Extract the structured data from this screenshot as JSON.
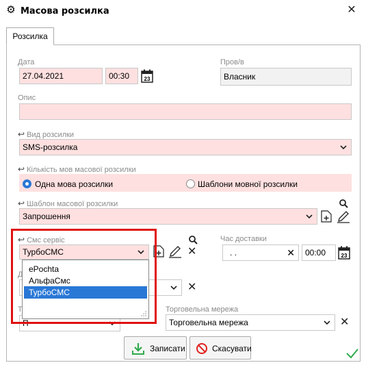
{
  "window": {
    "title": "Масова розсилка",
    "icon": "gear-icon",
    "close_icon": "close-icon"
  },
  "tab": {
    "label": "Розсилка"
  },
  "form": {
    "date_label": "Дата",
    "date_value": "27.04.2021",
    "time_value": "00:30",
    "provod_label": "Пров/в",
    "provod_value": "Власник",
    "description_label": "Опис",
    "description_value": "",
    "mailing_type_label": "Вид розсилки",
    "mailing_type_value": "SMS-розсилка",
    "lang_count_label": "Кількість мов масової розсилки",
    "lang_option_1": "Одна мова розсилки",
    "lang_option_2": "Шаблони мовної розсилки",
    "lang_selected": "Одна мова розсилки",
    "template_label": "Шаблон масової розсилки",
    "template_value": "Запрошення",
    "sms_service_label": "Смс сервіс",
    "sms_service_value": "ТурбоСМС",
    "delivery_time_label": "Час доставки",
    "delivery_date_value": " .  .",
    "delivery_time_value": "00:00",
    "hidden_label_letter": "Д",
    "hidden_label_letter_2": "Т",
    "hidden_value_letter": "П",
    "trade_network_label": "Торговельна мережа",
    "trade_network_value": "Торговельна мережа"
  },
  "sms_dropdown": {
    "options": [
      "ePochta",
      "АльфаСмс",
      "ТурбоСМС"
    ],
    "selected": "ТурбоСМС"
  },
  "buttons": {
    "save": "Записати",
    "cancel": "Скасувати"
  },
  "colors": {
    "required_field": "#ffe0e0",
    "accent": "#2a78d6",
    "highlight": "#e01010",
    "ok": "#2eaa4a"
  }
}
